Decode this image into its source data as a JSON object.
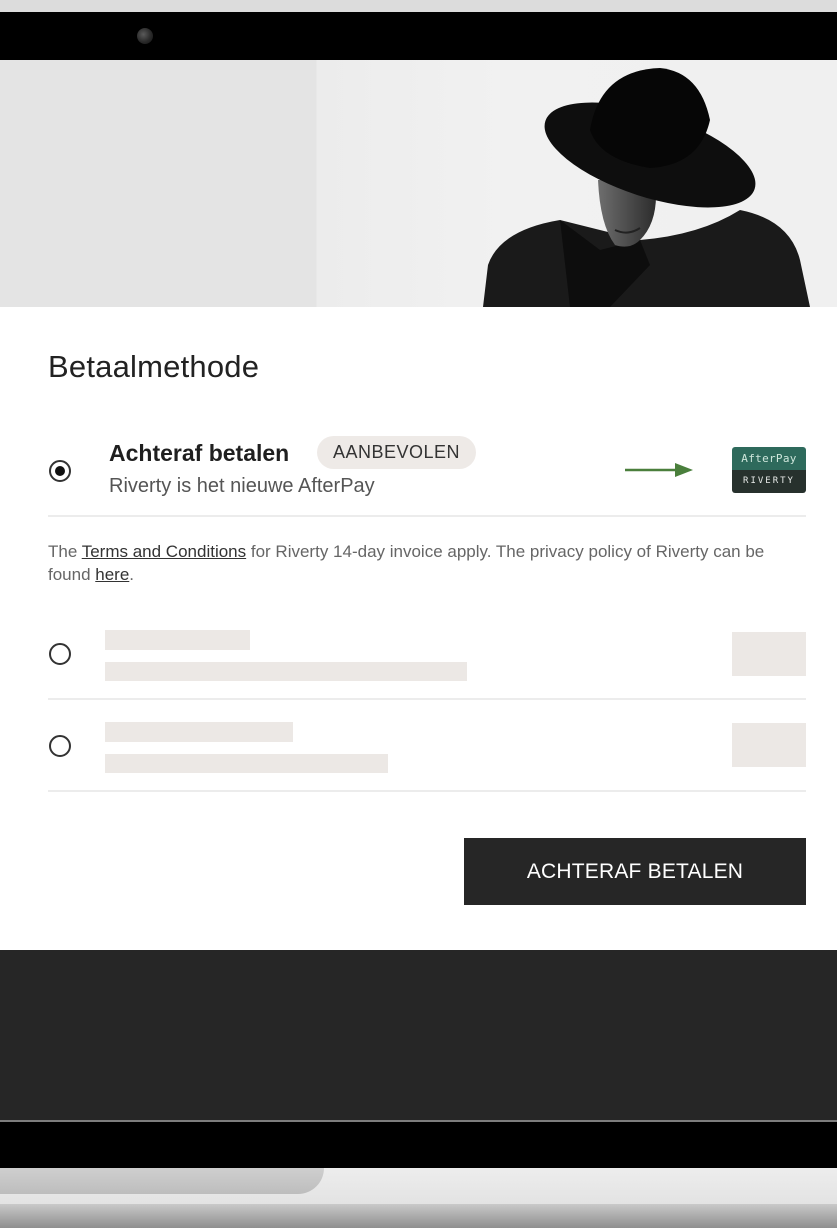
{
  "hero": {
    "image": "man-in-black-hat-photo"
  },
  "page_title": "Betaalmethode",
  "payment_option": {
    "title": "Achteraf betalen",
    "badge": "AANBEVOLEN",
    "subtitle": "Riverty is het nieuwe AfterPay",
    "selected": true,
    "logo_top": "AfterPay",
    "logo_bottom": "RIVERTY",
    "arrow_color": "#4a7f3c"
  },
  "terms": {
    "before": "The ",
    "link1": "Terms and Conditions",
    "middle": " for Riverty 14-day invoice apply. The privacy policy of Riverty can be found ",
    "link2": "here",
    "after": "."
  },
  "cta_label": "ACHTERAF BETALEN",
  "colors": {
    "cta_bg": "#262626",
    "badge_bg": "#eeeae7",
    "placeholder": "#ece8e5"
  }
}
